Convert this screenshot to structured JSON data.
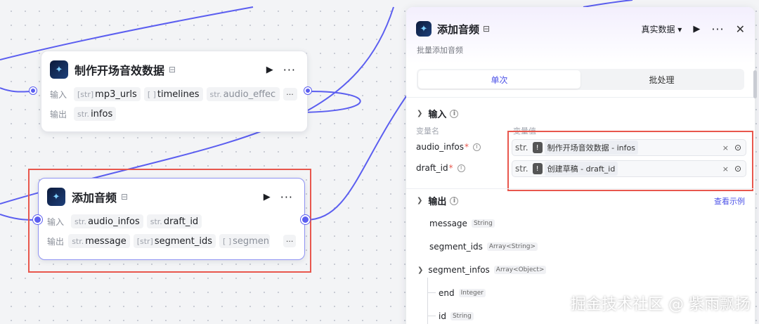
{
  "nodes": {
    "audio_data": {
      "title": "制作开场音效数据",
      "input_label": "输入",
      "output_label": "输出",
      "inputs": [
        {
          "type": "[str]",
          "name": "mp3_urls"
        },
        {
          "type": "[ ]",
          "name": "timelines"
        },
        {
          "type": "str.",
          "name": "audio_effec"
        }
      ],
      "outputs": [
        {
          "type": "str.",
          "name": "infos"
        }
      ],
      "more": "···"
    },
    "add_audio": {
      "title": "添加音频",
      "input_label": "输入",
      "output_label": "输出",
      "inputs": [
        {
          "type": "str.",
          "name": "audio_infos"
        },
        {
          "type": "str.",
          "name": "draft_id"
        }
      ],
      "outputs": [
        {
          "type": "str.",
          "name": "message"
        },
        {
          "type": "[str]",
          "name": "segment_ids"
        },
        {
          "type": "[ ]",
          "name": "segmen"
        }
      ],
      "more": "···"
    }
  },
  "panel": {
    "title": "添加音频",
    "description": "批量添加音频",
    "mode": "真实数据",
    "tabs": [
      "单次",
      "批处理"
    ],
    "input_section": "输入",
    "col_name": "变量名",
    "col_value": "变量值",
    "inputs": [
      {
        "name": "audio_infos",
        "required": "*",
        "type": "str.",
        "ref": "制作开场音效数据 - infos",
        "clear": "×"
      },
      {
        "name": "draft_id",
        "required": "*",
        "type": "str.",
        "ref": "创建草稿 - draft_id",
        "clear": "×"
      }
    ],
    "output_section": "输出",
    "view_example": "查看示例",
    "outputs": [
      {
        "name": "message",
        "type": "String"
      },
      {
        "name": "segment_ids",
        "type": "Array<String>"
      },
      {
        "name": "segment_infos",
        "type": "Array<Object>"
      },
      {
        "name": "end",
        "type": "Integer"
      },
      {
        "name": "id",
        "type": "String"
      }
    ]
  },
  "watermark": "掘金技术社区 @ 紫雨飘扬",
  "colors": {
    "accent": "#4d53e8",
    "wire": "#5b5ef0",
    "highlight": "#e8574d"
  }
}
